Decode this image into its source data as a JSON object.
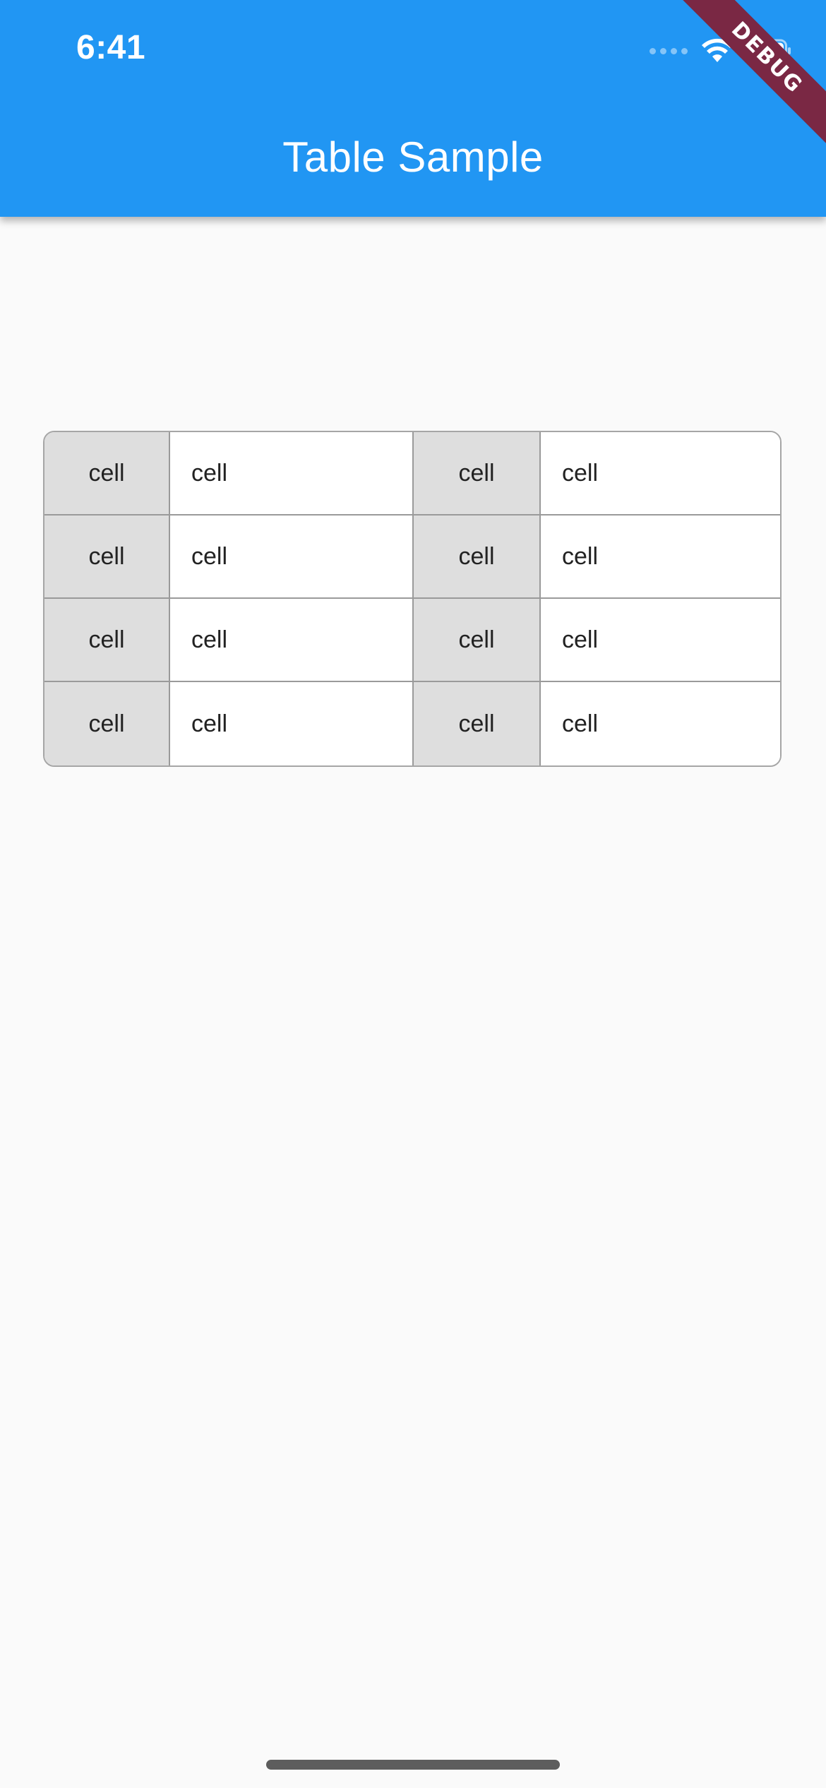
{
  "status_bar": {
    "time": "6:41"
  },
  "app_bar": {
    "title": "Table Sample",
    "color": "#2196f3"
  },
  "debug_banner": {
    "label": "DEBUG",
    "color": "#7a2844"
  },
  "table": {
    "rows": [
      [
        "cell",
        "cell",
        "cell",
        "cell"
      ],
      [
        "cell",
        "cell",
        "cell",
        "cell"
      ],
      [
        "cell",
        "cell",
        "cell",
        "cell"
      ],
      [
        "cell",
        "cell",
        "cell",
        "cell"
      ]
    ],
    "header_columns": [
      0,
      2
    ],
    "header_cell_color": "#dedede",
    "body_cell_color": "#ffffff",
    "border_color": "#9a9a9a"
  },
  "icons": {
    "signal": "cellular-signal-icon",
    "wifi": "wifi-icon",
    "battery": "battery-icon"
  }
}
